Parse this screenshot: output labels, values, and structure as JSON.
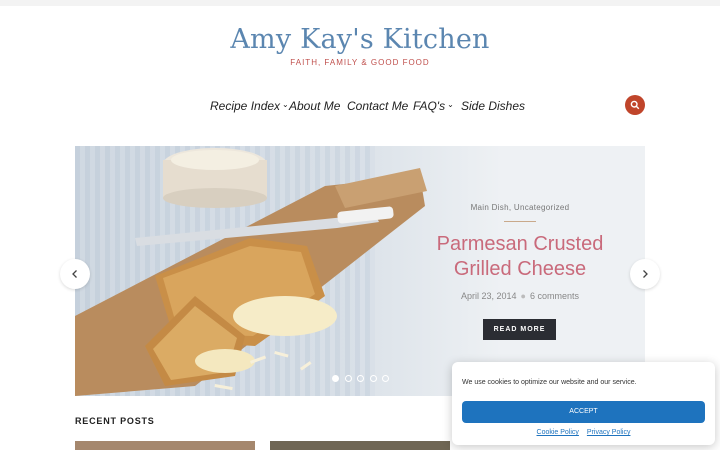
{
  "header": {
    "site_title": "Amy Kay's Kitchen",
    "tagline": "FAITH, FAMILY & GOOD FOOD"
  },
  "nav": {
    "items": [
      {
        "label": "Recipe Index",
        "has_dropdown": true
      },
      {
        "label": "About Me",
        "has_dropdown": false
      },
      {
        "label": "Contact Me",
        "has_dropdown": false
      },
      {
        "label": "FAQ's",
        "has_dropdown": true
      },
      {
        "label": "Side Dishes",
        "has_dropdown": false
      }
    ],
    "search_icon": "search-icon"
  },
  "slider": {
    "categories": "Main Dish, Uncategorized",
    "title": "Parmesan Crusted Grilled Cheese",
    "date": "April 23, 2014",
    "comments": "6 comments",
    "read_more": "READ MORE",
    "slide_count": 5,
    "active_slide": 1
  },
  "recent": {
    "title": "RECENT POSTS"
  },
  "cookie": {
    "message": "We use cookies to optimize our website and our service.",
    "accept": "ACCEPT",
    "links": [
      "Cookie Policy",
      "Privacy Policy"
    ]
  },
  "colors": {
    "title": "#5b86b0",
    "accent": "#c0452b",
    "post_title": "#c96a7b",
    "button_dark": "#2b2d33",
    "cookie_button": "#1e73be"
  }
}
